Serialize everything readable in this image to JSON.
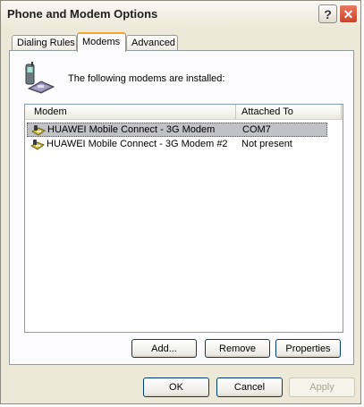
{
  "window": {
    "title": "Phone and Modem Options"
  },
  "tabs": [
    {
      "label": "Dialing Rules"
    },
    {
      "label": "Modems",
      "selected": true
    },
    {
      "label": "Advanced"
    }
  ],
  "panel": {
    "intro_text": "The following modems are  installed:",
    "columns": {
      "modem": "Modem",
      "attached_to": "Attached To"
    },
    "modems": [
      {
        "name": "HUAWEI Mobile Connect - 3G Modem",
        "attached_to": "COM7",
        "selected": true
      },
      {
        "name": "HUAWEI Mobile Connect - 3G Modem #2",
        "attached_to": "Not present",
        "selected": false
      }
    ],
    "buttons": {
      "add": "Add...",
      "remove": "Remove",
      "properties": "Properties"
    }
  },
  "dialog_buttons": {
    "ok": "OK",
    "cancel": "Cancel",
    "apply": "Apply"
  },
  "colors": {
    "face": "#ece9d8",
    "selection": "#c1c2c6",
    "close_button": "#c8452b",
    "active_tab_accent": "#f2a533"
  }
}
